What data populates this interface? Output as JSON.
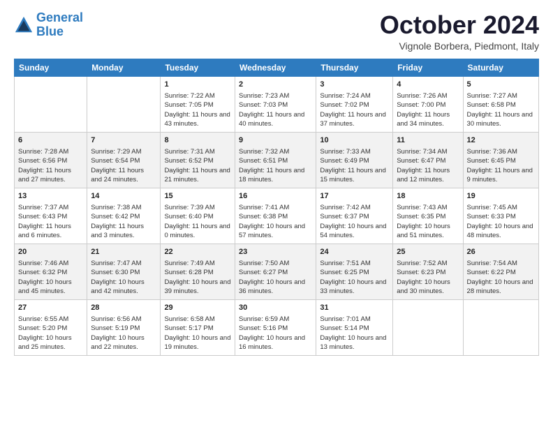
{
  "header": {
    "logo_line1": "General",
    "logo_line2": "Blue",
    "month": "October 2024",
    "location": "Vignole Borbera, Piedmont, Italy"
  },
  "weekdays": [
    "Sunday",
    "Monday",
    "Tuesday",
    "Wednesday",
    "Thursday",
    "Friday",
    "Saturday"
  ],
  "weeks": [
    [
      {
        "day": "",
        "content": ""
      },
      {
        "day": "",
        "content": ""
      },
      {
        "day": "1",
        "content": "Sunrise: 7:22 AM\nSunset: 7:05 PM\nDaylight: 11 hours and 43 minutes."
      },
      {
        "day": "2",
        "content": "Sunrise: 7:23 AM\nSunset: 7:03 PM\nDaylight: 11 hours and 40 minutes."
      },
      {
        "day": "3",
        "content": "Sunrise: 7:24 AM\nSunset: 7:02 PM\nDaylight: 11 hours and 37 minutes."
      },
      {
        "day": "4",
        "content": "Sunrise: 7:26 AM\nSunset: 7:00 PM\nDaylight: 11 hours and 34 minutes."
      },
      {
        "day": "5",
        "content": "Sunrise: 7:27 AM\nSunset: 6:58 PM\nDaylight: 11 hours and 30 minutes."
      }
    ],
    [
      {
        "day": "6",
        "content": "Sunrise: 7:28 AM\nSunset: 6:56 PM\nDaylight: 11 hours and 27 minutes."
      },
      {
        "day": "7",
        "content": "Sunrise: 7:29 AM\nSunset: 6:54 PM\nDaylight: 11 hours and 24 minutes."
      },
      {
        "day": "8",
        "content": "Sunrise: 7:31 AM\nSunset: 6:52 PM\nDaylight: 11 hours and 21 minutes."
      },
      {
        "day": "9",
        "content": "Sunrise: 7:32 AM\nSunset: 6:51 PM\nDaylight: 11 hours and 18 minutes."
      },
      {
        "day": "10",
        "content": "Sunrise: 7:33 AM\nSunset: 6:49 PM\nDaylight: 11 hours and 15 minutes."
      },
      {
        "day": "11",
        "content": "Sunrise: 7:34 AM\nSunset: 6:47 PM\nDaylight: 11 hours and 12 minutes."
      },
      {
        "day": "12",
        "content": "Sunrise: 7:36 AM\nSunset: 6:45 PM\nDaylight: 11 hours and 9 minutes."
      }
    ],
    [
      {
        "day": "13",
        "content": "Sunrise: 7:37 AM\nSunset: 6:43 PM\nDaylight: 11 hours and 6 minutes."
      },
      {
        "day": "14",
        "content": "Sunrise: 7:38 AM\nSunset: 6:42 PM\nDaylight: 11 hours and 3 minutes."
      },
      {
        "day": "15",
        "content": "Sunrise: 7:39 AM\nSunset: 6:40 PM\nDaylight: 11 hours and 0 minutes."
      },
      {
        "day": "16",
        "content": "Sunrise: 7:41 AM\nSunset: 6:38 PM\nDaylight: 10 hours and 57 minutes."
      },
      {
        "day": "17",
        "content": "Sunrise: 7:42 AM\nSunset: 6:37 PM\nDaylight: 10 hours and 54 minutes."
      },
      {
        "day": "18",
        "content": "Sunrise: 7:43 AM\nSunset: 6:35 PM\nDaylight: 10 hours and 51 minutes."
      },
      {
        "day": "19",
        "content": "Sunrise: 7:45 AM\nSunset: 6:33 PM\nDaylight: 10 hours and 48 minutes."
      }
    ],
    [
      {
        "day": "20",
        "content": "Sunrise: 7:46 AM\nSunset: 6:32 PM\nDaylight: 10 hours and 45 minutes."
      },
      {
        "day": "21",
        "content": "Sunrise: 7:47 AM\nSunset: 6:30 PM\nDaylight: 10 hours and 42 minutes."
      },
      {
        "day": "22",
        "content": "Sunrise: 7:49 AM\nSunset: 6:28 PM\nDaylight: 10 hours and 39 minutes."
      },
      {
        "day": "23",
        "content": "Sunrise: 7:50 AM\nSunset: 6:27 PM\nDaylight: 10 hours and 36 minutes."
      },
      {
        "day": "24",
        "content": "Sunrise: 7:51 AM\nSunset: 6:25 PM\nDaylight: 10 hours and 33 minutes."
      },
      {
        "day": "25",
        "content": "Sunrise: 7:52 AM\nSunset: 6:23 PM\nDaylight: 10 hours and 30 minutes."
      },
      {
        "day": "26",
        "content": "Sunrise: 7:54 AM\nSunset: 6:22 PM\nDaylight: 10 hours and 28 minutes."
      }
    ],
    [
      {
        "day": "27",
        "content": "Sunrise: 6:55 AM\nSunset: 5:20 PM\nDaylight: 10 hours and 25 minutes."
      },
      {
        "day": "28",
        "content": "Sunrise: 6:56 AM\nSunset: 5:19 PM\nDaylight: 10 hours and 22 minutes."
      },
      {
        "day": "29",
        "content": "Sunrise: 6:58 AM\nSunset: 5:17 PM\nDaylight: 10 hours and 19 minutes."
      },
      {
        "day": "30",
        "content": "Sunrise: 6:59 AM\nSunset: 5:16 PM\nDaylight: 10 hours and 16 minutes."
      },
      {
        "day": "31",
        "content": "Sunrise: 7:01 AM\nSunset: 5:14 PM\nDaylight: 10 hours and 13 minutes."
      },
      {
        "day": "",
        "content": ""
      },
      {
        "day": "",
        "content": ""
      }
    ]
  ]
}
